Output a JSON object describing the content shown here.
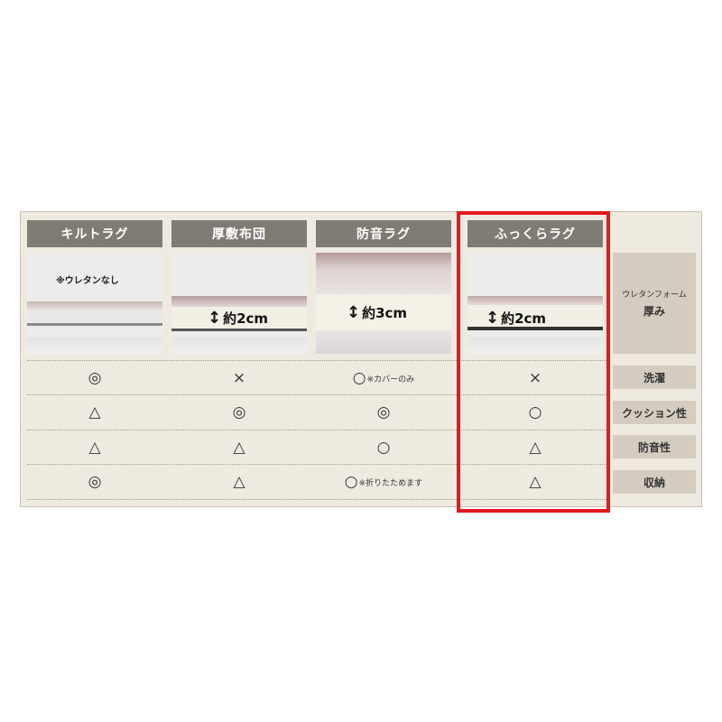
{
  "columns": [
    {
      "header": "キルトラグ"
    },
    {
      "header": "厚敷布団",
      "thickness": "約2cm"
    },
    {
      "header": "防音ラグ",
      "thickness": "約3cm"
    },
    {
      "header": "ふっくらラグ",
      "thickness": "約2cm"
    }
  ],
  "quilt_note": "※ウレタンなし",
  "side_header": {
    "small": "ウレタンフォーム",
    "big": "厚み"
  },
  "row_labels": [
    "洗濯",
    "クッション性",
    "防音性",
    "収納"
  ],
  "rows": [
    [
      {
        "symbol": "◎"
      },
      {
        "symbol": "×"
      },
      {
        "symbol": "○",
        "note": "※カバーのみ"
      },
      {
        "symbol": "×"
      }
    ],
    [
      {
        "symbol": "△"
      },
      {
        "symbol": "◎"
      },
      {
        "symbol": "◎"
      },
      {
        "symbol": "○"
      }
    ],
    [
      {
        "symbol": "△"
      },
      {
        "symbol": "△"
      },
      {
        "symbol": "○"
      },
      {
        "symbol": "△"
      }
    ],
    [
      {
        "symbol": "◎"
      },
      {
        "symbol": "△"
      },
      {
        "symbol": "○",
        "note": "※折りたためます"
      },
      {
        "symbol": "△"
      }
    ]
  ],
  "colors": {
    "panel_bg": "#efeadf",
    "header_bg": "#807b73",
    "label_bg": "#d4ccbf",
    "highlight": "#e3191e"
  }
}
